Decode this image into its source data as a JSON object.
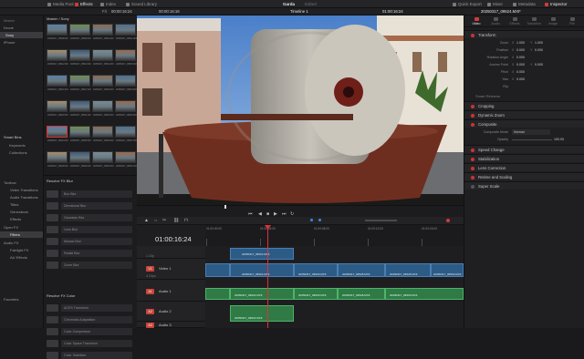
{
  "topbar": {
    "media_pool": "Media Pool",
    "effects": "Effects",
    "index": "Index",
    "sound_library": "Sound Library",
    "title": "Garda",
    "edited": "Edited",
    "quick_export": "Quick Export",
    "mixer": "Mixer",
    "metadata": "Metadata",
    "inspector": "Inspector"
  },
  "viewer_bar": {
    "fit": "Fit",
    "duration": "00:00:16:24",
    "source_tc": "00:00:16:18",
    "timeline_name": "Timeline 1",
    "record_tc": "01:00:16:24",
    "clip_name": "20250317_09524.MXF"
  },
  "left_panel": {
    "master": "Master",
    "items": [
      "Drone",
      "Sony",
      "iPhone"
    ],
    "smart_bins": "Smart Bins",
    "smart_items": [
      "Keywords",
      "Collections"
    ],
    "toolbox": "Toolbox",
    "toolbox_items": [
      "Video Transitions",
      "Audio Transitions",
      "Titles",
      "Generators",
      "Effects",
      "Open FX",
      "Filters",
      "Audio FX",
      "Fairlight FX",
      "AU Effects"
    ],
    "favorites": "Favorites"
  },
  "media_pool": {
    "header": "Master / Sony",
    "thumbs": [
      {
        "label": "20250317_09508.MXF"
      },
      {
        "label": "20250317_09509.MXF"
      },
      {
        "label": "20250317_09510.MXF"
      },
      {
        "label": "20250317_09511.MXF"
      },
      {
        "label": "20250317_09512.MXF"
      },
      {
        "label": "20250317_09513.MXF"
      },
      {
        "label": "20250317_09514.MXF"
      },
      {
        "label": "20250317_09515.MXF"
      },
      {
        "label": "20250317_09516.MXF"
      },
      {
        "label": "20250317_09517.MXF"
      },
      {
        "label": "20250317_09518.MXF"
      },
      {
        "label": "20250317_09519.MXF"
      },
      {
        "label": "20250317_09520.MXF"
      },
      {
        "label": "20250317_09521.MXF"
      },
      {
        "label": "20250317_09522.MXF"
      },
      {
        "label": "20250317_09523.MXF"
      },
      {
        "label": "20250317_09524.MXF"
      },
      {
        "label": "20250317_09525.MXF"
      },
      {
        "label": "20250317_09526.MXF"
      },
      {
        "label": "20250317_09527.MXF"
      },
      {
        "label": "20250317_09528.MXF"
      },
      {
        "label": "20250317_09529.MXF"
      },
      {
        "label": "20250317_09530.MXF"
      },
      {
        "label": "20250317_09531.MXF"
      }
    ]
  },
  "fx": {
    "blur_header": "Resolve FX Blur",
    "blur_items": [
      "Box Blur",
      "Directional Blur",
      "Gaussian Blur",
      "Lens Blur",
      "Mosaic Blur",
      "Radial Blur",
      "Zoom Blur"
    ],
    "color_header": "Resolve FX Color",
    "color_items": [
      "ACES Transform",
      "Chromatic Adaptation",
      "Color Compressor",
      "Color Space Transform",
      "Color Stabilizer"
    ]
  },
  "timeline": {
    "timecode": "01:00:16:24",
    "ruler": [
      "01:00:00:00",
      "01:00:04:00",
      "01:00:08:00",
      "01:00:12:00",
      "01:00:16:00",
      "01:00:20:00"
    ],
    "v1_name": "Video 1",
    "v1_clips": "4 Clips",
    "a1_name": "Audio 1",
    "a2_name": "Audio 2",
    "a3_name": "Audio 3",
    "clip_names": [
      "20250317_09524.MXF",
      "20250317_09526.MXF",
      "20250317_09528.MXF",
      "20250317_09528.MXF",
      "20250317_09530.MXF"
    ],
    "v2_clip": "20250317_09524.MXF",
    "a1_labels": [
      "20250317_09524.MXF",
      "20250317_09526.MXF",
      "20250317_09528.MXF",
      "20250317_09530.MXF"
    ]
  },
  "inspector": {
    "tabs": [
      "Video",
      "Audio",
      "Effects",
      "Transition",
      "Image",
      "File"
    ],
    "transform": "Transform",
    "rows": [
      {
        "label": "Zoom",
        "x": "1.000",
        "y": "1.000"
      },
      {
        "label": "Position",
        "x": "0.000",
        "y": "0.000"
      },
      {
        "label": "Rotation Angle",
        "x": "0.000",
        "y": ""
      },
      {
        "label": "Anchor Point",
        "x": "0.000",
        "y": "0.000"
      },
      {
        "label": "Pitch",
        "x": "0.000",
        "y": ""
      },
      {
        "label": "Yaw",
        "x": "0.000",
        "y": ""
      },
      {
        "label": "Flip",
        "x": "",
        "y": ""
      }
    ],
    "smart_reframe": "Smart Reframe",
    "sections": [
      "Cropping",
      "Dynamic Zoom",
      "Composite",
      "Speed Change",
      "Stabilization",
      "Lens Correction",
      "Retime and Scaling",
      "Super Scale"
    ],
    "composite_mode_label": "Composite Mode",
    "composite_mode": "Normal",
    "opacity_label": "Opacity",
    "opacity": "100.00"
  },
  "colors": {
    "accent_red": "#d23b3b",
    "clip_blue": "#2c5b86",
    "audio_green": "#2f7a45",
    "playhead": "#e0323a"
  }
}
